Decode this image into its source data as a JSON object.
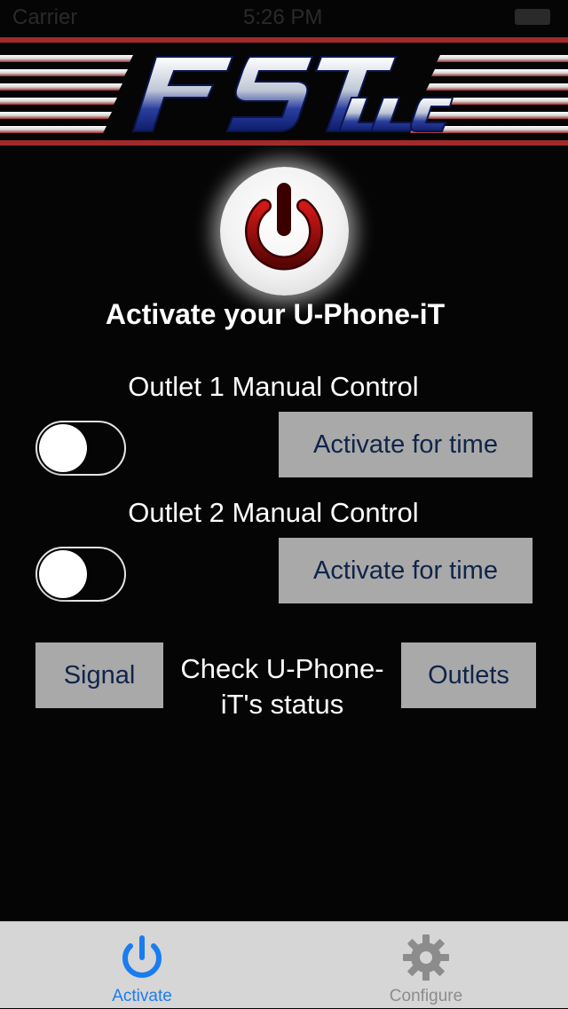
{
  "status_bar": {
    "carrier": "Carrier",
    "time": "5:26 PM"
  },
  "header": {
    "logo_text": "FST",
    "logo_suffix": "LLC"
  },
  "hero": {
    "title": "Activate your U-Phone-iT"
  },
  "outlet1": {
    "title": "Outlet 1 Manual Control",
    "toggle_on": false,
    "button_label": "Activate for time"
  },
  "outlet2": {
    "title": "Outlet 2 Manual Control",
    "toggle_on": false,
    "button_label": "Activate for time"
  },
  "status_check": {
    "signal_label": "Signal",
    "label": "Check U-Phone-iT's status",
    "outlets_label": "Outlets"
  },
  "tab_bar": {
    "tabs": [
      {
        "label": "Activate",
        "icon": "power-icon",
        "active": true
      },
      {
        "label": "Configure",
        "icon": "gear-icon",
        "active": false
      }
    ]
  },
  "colors": {
    "background": "#050505",
    "button_bg": "#a9a9a9",
    "button_text": "#10244a",
    "tab_active": "#1a7cf0",
    "tab_inactive": "#8c8c8c",
    "power_red": "#8a0a0a",
    "banner_red": "#a12a2a"
  }
}
